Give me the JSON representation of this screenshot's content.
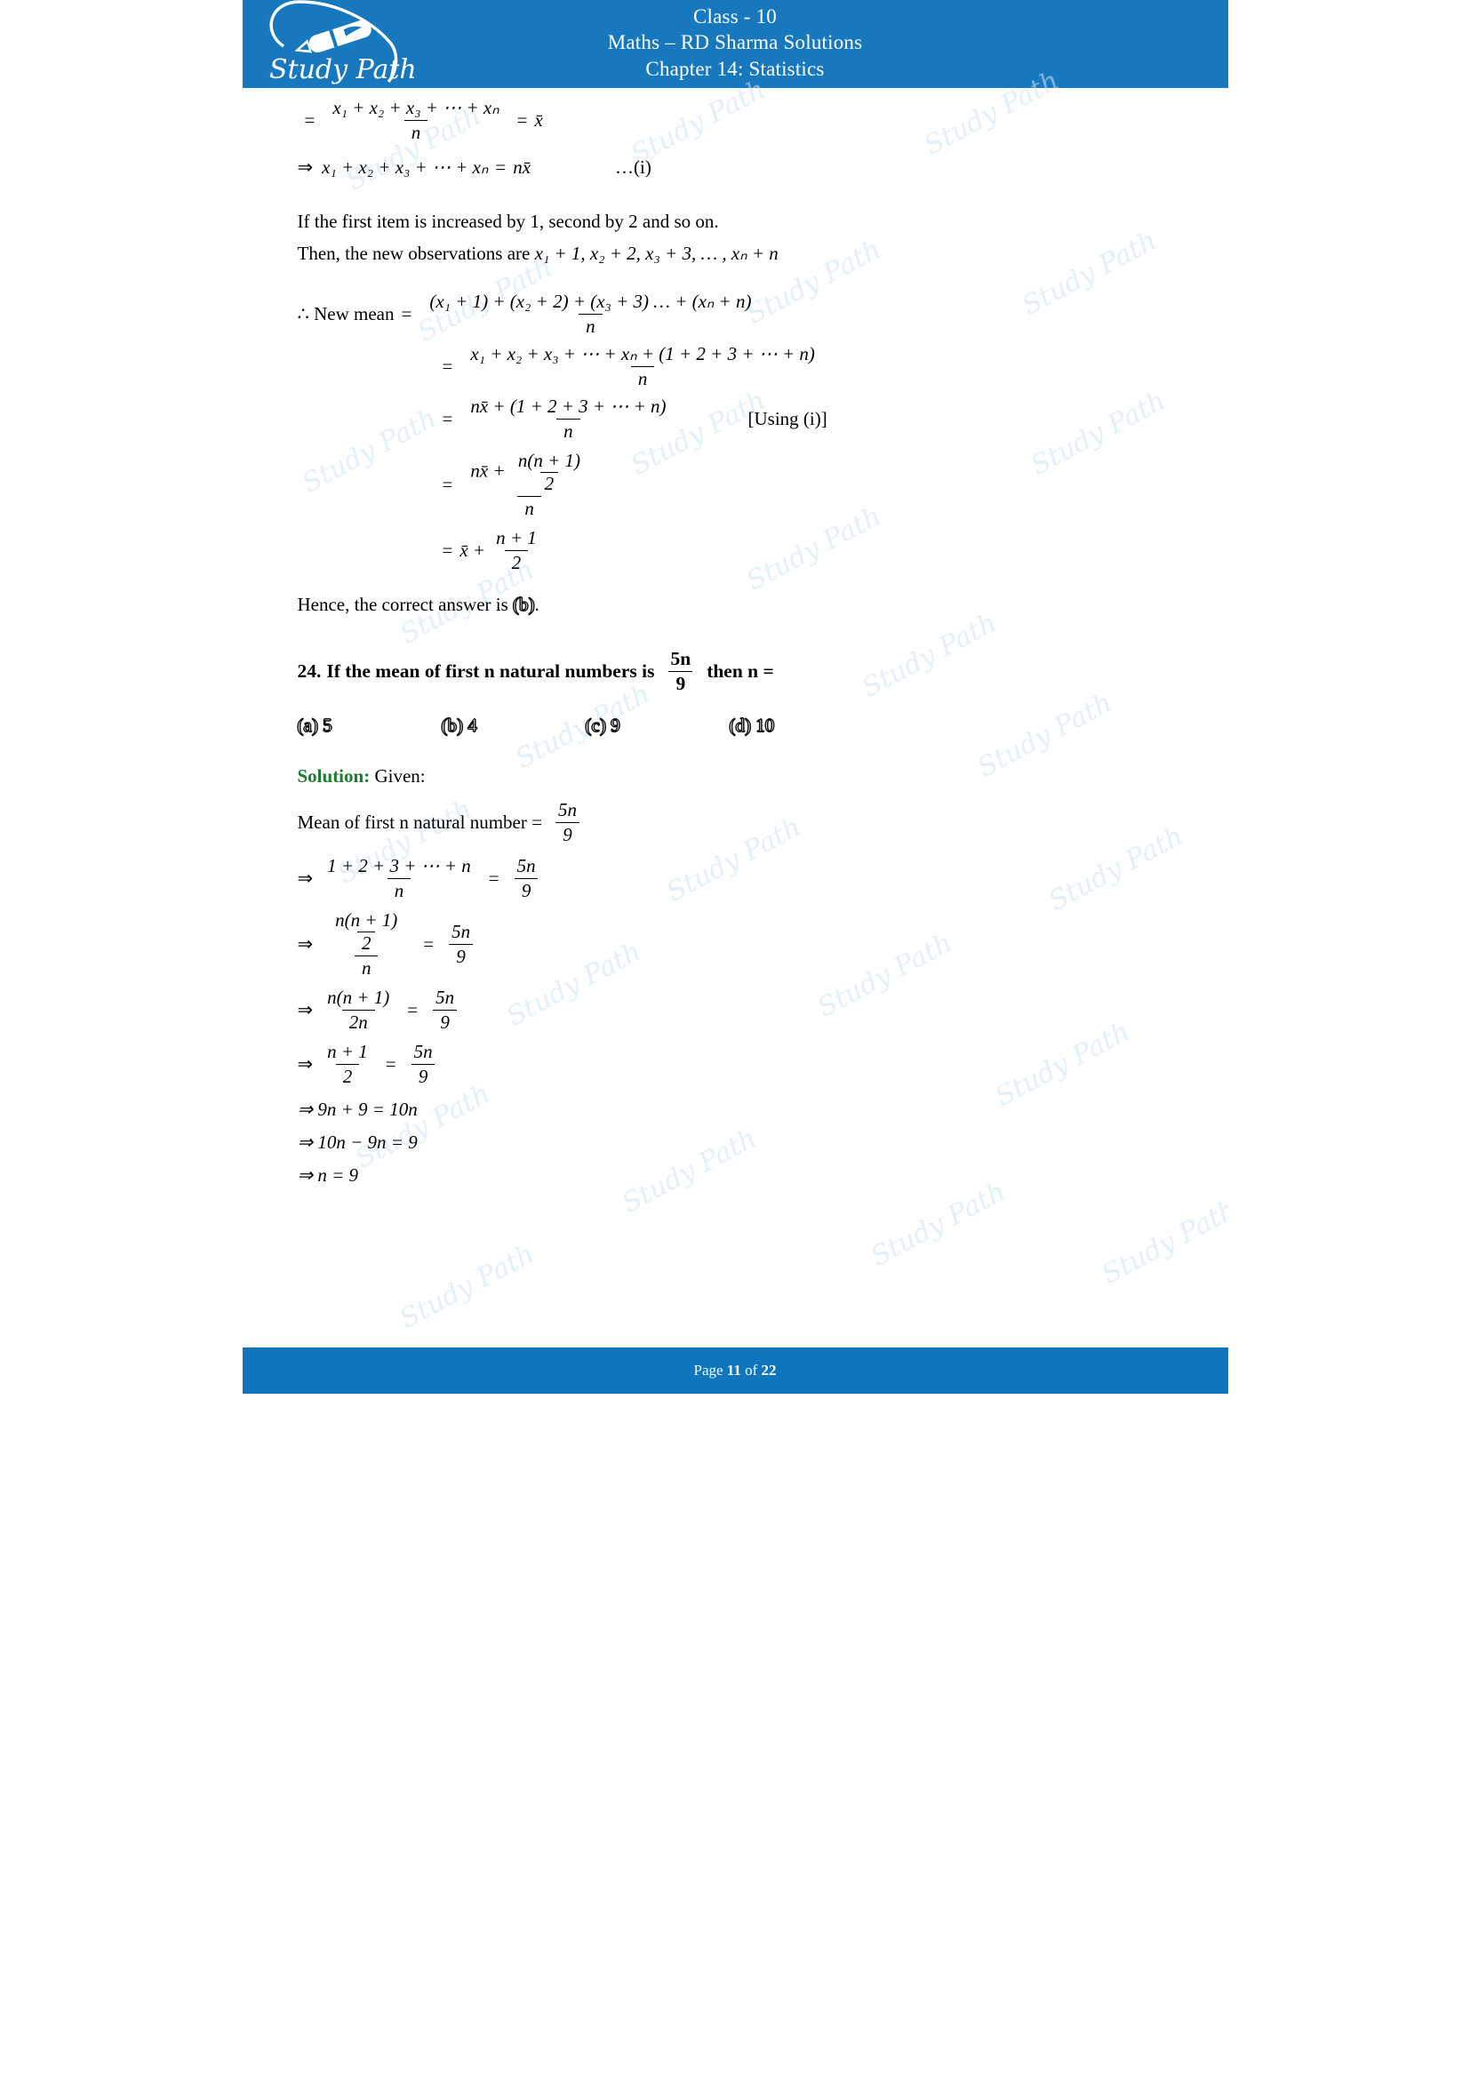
{
  "colors": {
    "header_bg": "#1878be",
    "footer_bg": "#0f76bd",
    "solution_green": "#1e7a2e",
    "watermark": "#cfe3f3"
  },
  "header": {
    "logo_text": "Study Path",
    "line1": "Class - 10",
    "line2": "Maths – RD Sharma Solutions",
    "line3": "Chapter 14: Statistics"
  },
  "footer": {
    "prefix": "Page",
    "page_number": "11",
    "middle": "of",
    "total_pages": "22"
  },
  "watermark_text": "Study Path",
  "body": {
    "eq1": {
      "eq_sign": "=",
      "numerator": "x₁ + x₂ + x₃ + ⋯ + xₙ",
      "denominator": "n",
      "equals": "=",
      "result": "x̄"
    },
    "eq2": {
      "arrow": "⇒",
      "lhs": "x₁ + x₂ + x₃ + ⋯ + xₙ",
      "equals": "=",
      "rhs": "nx̄",
      "tag": "…(i)"
    },
    "para1": "If the first item is increased by 1, second by 2 and so on.",
    "para2_prefix": "Then, the new observations are ",
    "para2_math": "x₁ + 1, x₂ + 2, x₃ + 3, … , xₙ + n",
    "newmean": {
      "label": "∴ New mean",
      "equals": "=",
      "step1_num": "(x₁ + 1) + (x₂ + 2) + (x₃ + 3) … + (xₙ + n)",
      "step1_den": "n",
      "step2_num": "x₁ + x₂ + x₃ + ⋯ + xₙ + (1 + 2 + 3 + ⋯ + n)",
      "step2_den": "n",
      "step3_num": "nx̄ + (1 + 2 + 3 + ⋯ + n)",
      "step3_den": "n",
      "step3_note": "[Using (i)]",
      "step4_num_left": "nx̄ +",
      "step4_inner_num": "n(n + 1)",
      "step4_inner_den": "2",
      "step4_den": "n",
      "step5_left": "x̄ +",
      "step5_num": "n + 1",
      "step5_den": "2"
    },
    "hence": {
      "text_before": "Hence, the correct answer is ",
      "answer": "(b)",
      "text_after": "."
    },
    "question": {
      "number": "24.",
      "text_before": "If the mean of first n natural numbers is",
      "frac_num": "5n",
      "frac_den": "9",
      "text_after": "then n  =",
      "options": [
        {
          "label": "(a)",
          "value": "5"
        },
        {
          "label": "(b)",
          "value": "4"
        },
        {
          "label": "(c)",
          "value": "9"
        },
        {
          "label": "(d)",
          "value": "10"
        }
      ]
    },
    "solution": {
      "label": "Solution:",
      "given": "Given:",
      "line1_text": "Mean of first n natural number  =",
      "line1_num": "5n",
      "line1_den": "9",
      "step1": {
        "arrow": "⇒",
        "lnum": "1 + 2 + 3 + ⋯ + n",
        "lden": "n",
        "eq": "=",
        "rnum": "5n",
        "rden": "9"
      },
      "step2": {
        "arrow": "⇒",
        "lnum_top": "n(n + 1)",
        "lnum_bot": "2",
        "lden": "n",
        "eq": "=",
        "rnum": "5n",
        "rden": "9"
      },
      "step3": {
        "arrow": "⇒",
        "lnum": "n(n + 1)",
        "lden": "2n",
        "eq": "=",
        "rnum": "5n",
        "rden": "9"
      },
      "step4": {
        "arrow": "⇒",
        "lnum": "n + 1",
        "lden": "2",
        "eq": "=",
        "rnum": "5n",
        "rden": "9"
      },
      "step5": "⇒ 9n + 9 = 10n",
      "step6": "⇒ 10n − 9n = 9",
      "step7": "⇒ n = 9"
    }
  }
}
